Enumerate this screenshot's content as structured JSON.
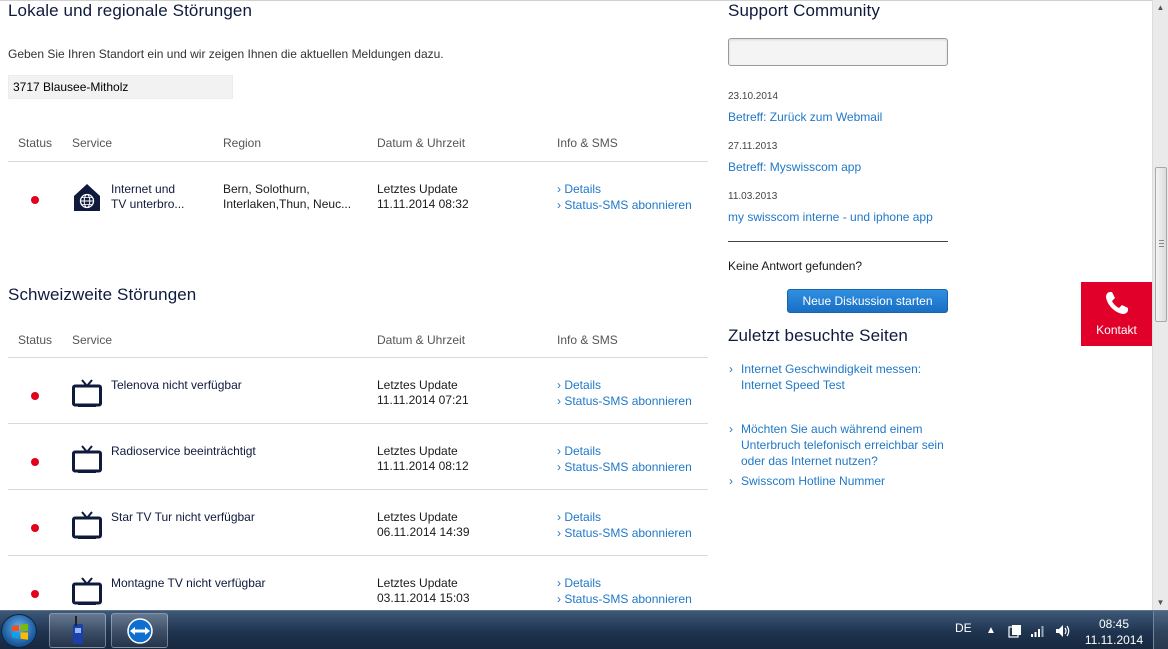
{
  "local": {
    "heading": "Lokale und regionale Störungen",
    "intro": "Geben Sie Ihren Standort ein und wir zeigen Ihnen die aktuellen Meldungen dazu.",
    "location_value": "3717 Blausee-Mitholz",
    "columns": [
      "Status",
      "Service",
      "Region",
      "Datum & Uhrzeit",
      "Info & SMS"
    ],
    "rows": [
      {
        "status": "red",
        "icon": "house-globe-icon",
        "service_line1": "Internet und",
        "service_line2": "TV unterbro...",
        "region_line1": "Bern, Solothurn,",
        "region_line2": "Interlaken,Thun, Neuc...",
        "date_label": "Letztes Update",
        "date_value": "11.11.2014 08:32",
        "details_label": "Details",
        "sms_label": "Status-SMS abonnieren"
      }
    ]
  },
  "national": {
    "heading": "Schweizweite Störungen",
    "columns": [
      "Status",
      "Service",
      "Datum & Uhrzeit",
      "Info & SMS"
    ],
    "rows": [
      {
        "status": "red",
        "icon": "tv-icon",
        "service": "Telenova nicht verfügbar",
        "date_label": "Letztes Update",
        "date_value": "11.11.2014 07:21",
        "details_label": "Details",
        "sms_label": "Status-SMS abonnieren"
      },
      {
        "status": "red",
        "icon": "tv-icon",
        "service": "Radioservice beeinträchtigt",
        "date_label": "Letztes Update",
        "date_value": "11.11.2014 08:12",
        "details_label": "Details",
        "sms_label": "Status-SMS abonnieren"
      },
      {
        "status": "red",
        "icon": "tv-icon",
        "service": "Star TV Tur nicht verfügbar",
        "date_label": "Letztes Update",
        "date_value": "06.11.2014 14:39",
        "details_label": "Details",
        "sms_label": "Status-SMS abonnieren"
      },
      {
        "status": "red",
        "icon": "tv-icon",
        "service": "Montagne TV nicht verfügbar",
        "date_label": "Letztes Update",
        "date_value": "03.11.2014 15:03",
        "details_label": "Details",
        "sms_label": "Status-SMS abonnieren"
      }
    ]
  },
  "community": {
    "heading": "Support Community",
    "search_value": "",
    "posts": [
      {
        "date": "23.10.2014",
        "title": "Betreff: Zurück zum Webmail"
      },
      {
        "date": "27.11.2013",
        "title": "Betreff: Myswisscom app"
      },
      {
        "date": "11.03.2013",
        "title": "my swisscom interne - und iphone app"
      }
    ],
    "no_answer": "Keine Antwort gefunden?",
    "new_discussion_label": "Neue Diskussion starten"
  },
  "recent": {
    "heading": "Zuletzt besuchte Seiten",
    "items": [
      "Internet Geschwindigkeit messen: Internet Speed Test",
      "Möchten Sie auch während einem Unterbruch telefonisch erreichbar sein oder das Internet nutzen?",
      "Swisscom Hotline Nummer"
    ]
  },
  "kontakt_label": "Kontakt",
  "taskbar": {
    "language": "DE",
    "time": "08:45",
    "date": "11.11.2014"
  },
  "colors": {
    "status_red": "#e2001a",
    "link_blue": "#1f78c8",
    "heading_navy": "#0f1a3d",
    "kontakt_red": "#e0002a"
  }
}
